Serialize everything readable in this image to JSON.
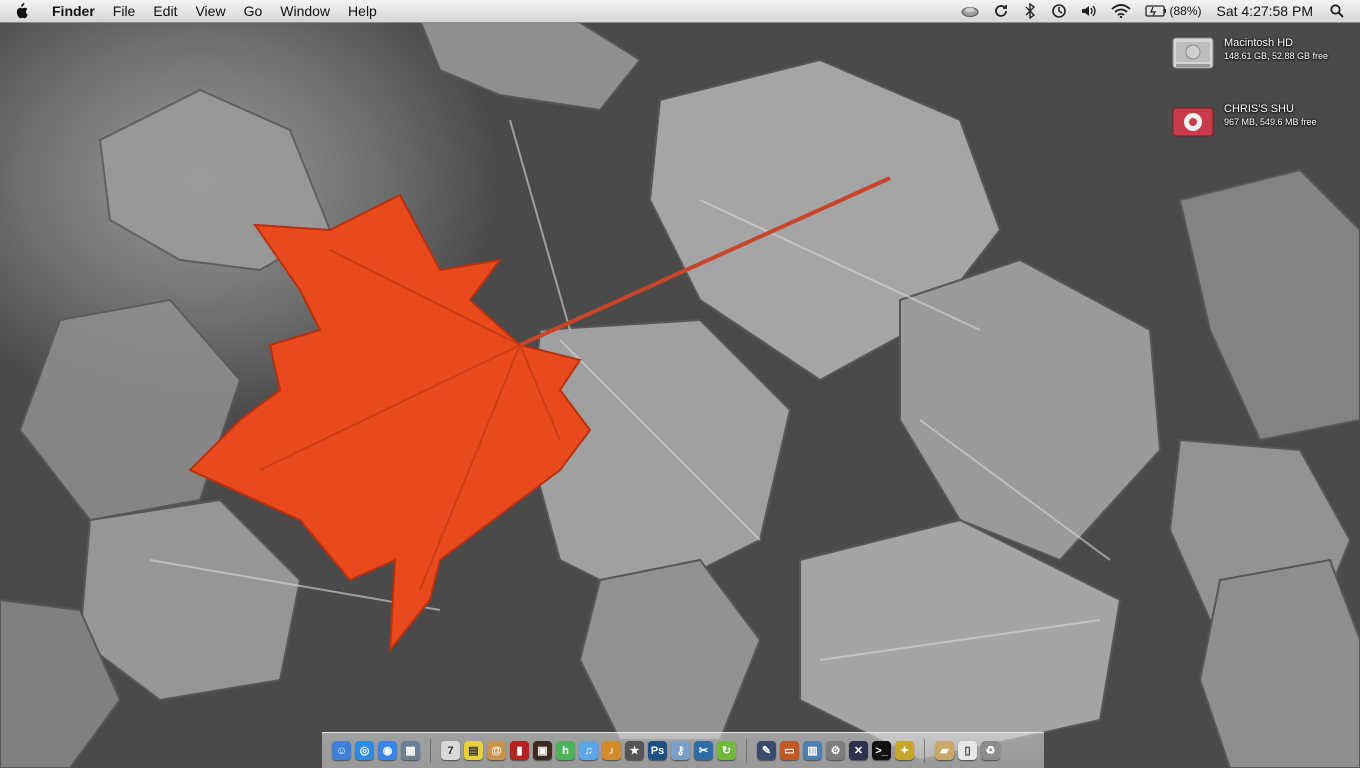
{
  "menubar": {
    "app_name": "Finder",
    "menus": [
      "File",
      "Edit",
      "View",
      "Go",
      "Window",
      "Help"
    ],
    "battery_percent": "(88%)",
    "clock": "Sat 4:27:58 PM"
  },
  "desktop": {
    "drives": [
      {
        "name": "Macintosh HD",
        "info": "148.61 GB, 52.88 GB free",
        "icon": "hard-drive-icon"
      },
      {
        "name": "CHRIS'S SHU",
        "info": "967 MB, 549.6 MB free",
        "icon": "ipod-shuffle-icon"
      }
    ]
  },
  "dock": {
    "items": [
      {
        "name": "finder",
        "color": "#3f7fd6",
        "glyph": "☺"
      },
      {
        "name": "safari",
        "color": "#2d8be0",
        "glyph": "◎"
      },
      {
        "name": "ichat",
        "color": "#3a86e8",
        "glyph": "◉"
      },
      {
        "name": "preview",
        "color": "#6d7f96",
        "glyph": "▦"
      },
      {
        "name": "ical",
        "color": "#d8d8d8",
        "glyph": "7"
      },
      {
        "name": "stickies",
        "color": "#e9cf3a",
        "glyph": "▤"
      },
      {
        "name": "address-book",
        "color": "#c9944a",
        "glyph": "@"
      },
      {
        "name": "book",
        "color": "#b3231f",
        "glyph": "▮"
      },
      {
        "name": "photo-booth",
        "color": "#3d2b1f",
        "glyph": "▣"
      },
      {
        "name": "hulu",
        "color": "#4db35a",
        "glyph": "h"
      },
      {
        "name": "itunes",
        "color": "#5aa6e6",
        "glyph": "♫"
      },
      {
        "name": "garageband",
        "color": "#d38b2a",
        "glyph": "♪"
      },
      {
        "name": "imovie-star",
        "color": "#555555",
        "glyph": "★"
      },
      {
        "name": "photoshop",
        "color": "#1c4f86",
        "glyph": "Ps"
      },
      {
        "name": "keychain",
        "color": "#7a9fc9",
        "glyph": "⚷"
      },
      {
        "name": "final-cut",
        "color": "#2b6ea6",
        "glyph": "✂"
      },
      {
        "name": "sync",
        "color": "#6fb83a",
        "glyph": "↻"
      },
      {
        "name": "brush",
        "color": "#3b4b6e",
        "glyph": "✎"
      },
      {
        "name": "presentation",
        "color": "#c4571f",
        "glyph": "▭"
      },
      {
        "name": "charts",
        "color": "#4f7fb0",
        "glyph": "▥"
      },
      {
        "name": "system-prefs",
        "color": "#7d7d7d",
        "glyph": "⚙"
      },
      {
        "name": "x11",
        "color": "#2f2f4f",
        "glyph": "✕"
      },
      {
        "name": "terminal",
        "color": "#111111",
        "glyph": ">_"
      },
      {
        "name": "pin",
        "color": "#c7a62a",
        "glyph": "✦"
      },
      {
        "name": "documents-folder",
        "color": "#c9a86a",
        "glyph": "▰"
      },
      {
        "name": "file",
        "color": "#e6e6e6",
        "glyph": "▯"
      },
      {
        "name": "trash",
        "color": "#8c8c8c",
        "glyph": "♻"
      }
    ]
  },
  "colors": {
    "leaf": "#e84a1d",
    "menubar_text": "#111111"
  }
}
